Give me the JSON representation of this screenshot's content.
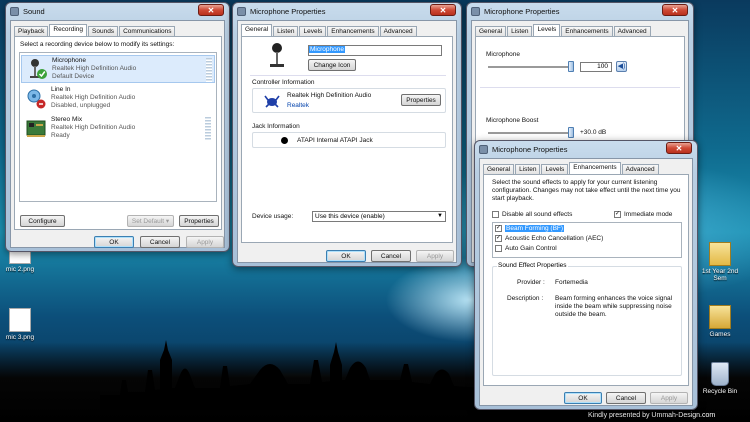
{
  "sound_window": {
    "title": "Sound",
    "tabs": [
      "Playback",
      "Recording",
      "Sounds",
      "Communications"
    ],
    "instruction": "Select a recording device below to modify its settings:",
    "devices": [
      {
        "name": "Microphone",
        "driver": "Realtek High Definition Audio",
        "status": "Default Device"
      },
      {
        "name": "Line In",
        "driver": "Realtek High Definition Audio",
        "status": "Disabled, unplugged"
      },
      {
        "name": "Stereo Mix",
        "driver": "Realtek High Definition Audio",
        "status": "Ready"
      }
    ],
    "configure_label": "Configure",
    "set_default_label": "Set Default",
    "properties_label": "Properties",
    "ok_label": "OK",
    "cancel_label": "Cancel",
    "apply_label": "Apply"
  },
  "mic_general": {
    "title": "Microphone Properties",
    "tabs": [
      "General",
      "Listen",
      "Levels",
      "Enhancements",
      "Advanced"
    ],
    "name_value": "Microphone",
    "change_icon_label": "Change Icon",
    "controller_heading": "Controller Information",
    "controller_name": "Realtek High Definition Audio",
    "controller_vendor": "Realtek",
    "properties_label": "Properties",
    "jack_heading": "Jack Information",
    "jack_name": "ATAPI Internal ATAPI Jack",
    "device_usage_label": "Device usage:",
    "device_usage_value": "Use this device (enable)",
    "ok_label": "OK",
    "cancel_label": "Cancel",
    "apply_label": "Apply"
  },
  "mic_levels": {
    "title": "Microphone Properties",
    "tabs": [
      "General",
      "Listen",
      "Levels",
      "Enhancements",
      "Advanced"
    ],
    "microphone_label": "Microphone",
    "microphone_value": "100",
    "boost_label": "Microphone Boost",
    "boost_value": "+30.0 dB"
  },
  "mic_enh": {
    "title": "Microphone Properties",
    "tabs": [
      "General",
      "Listen",
      "Levels",
      "Enhancements",
      "Advanced"
    ],
    "description": "Select the sound effects to apply for your current listening configuration. Changes may not take effect until the next time you start playback.",
    "disable_all_label": "Disable all sound effects",
    "immediate_mode_label": "Immediate mode",
    "effects": [
      {
        "label": "Beam Forming (BF)",
        "checked": true,
        "selected": true
      },
      {
        "label": "Acoustic Echo Cancellation (AEC)",
        "checked": true,
        "selected": false
      },
      {
        "label": "Auto Gain Control",
        "checked": false,
        "selected": false
      }
    ],
    "props_heading": "Sound Effect Properties",
    "provider_label": "Provider :",
    "provider_value": "Fortemedia",
    "description_label": "Description :",
    "description_value": "Beam forming enhances the voice signal inside the beam while suppressing noise outside the beam.",
    "ok_label": "OK",
    "cancel_label": "Cancel",
    "apply_label": "Apply"
  },
  "desktop": {
    "icons_left": [
      "mic 2.png",
      "mic 3.png"
    ],
    "icons_right": [
      "1st Year 2nd Sem",
      "Games",
      "Recycle Bin"
    ],
    "credit": "Kindly presented by Ummah-Design.com"
  },
  "colors": {
    "accent_green": "#3aa13a",
    "selection": "#3399ff",
    "slider_blue": "#2a6fcf"
  }
}
